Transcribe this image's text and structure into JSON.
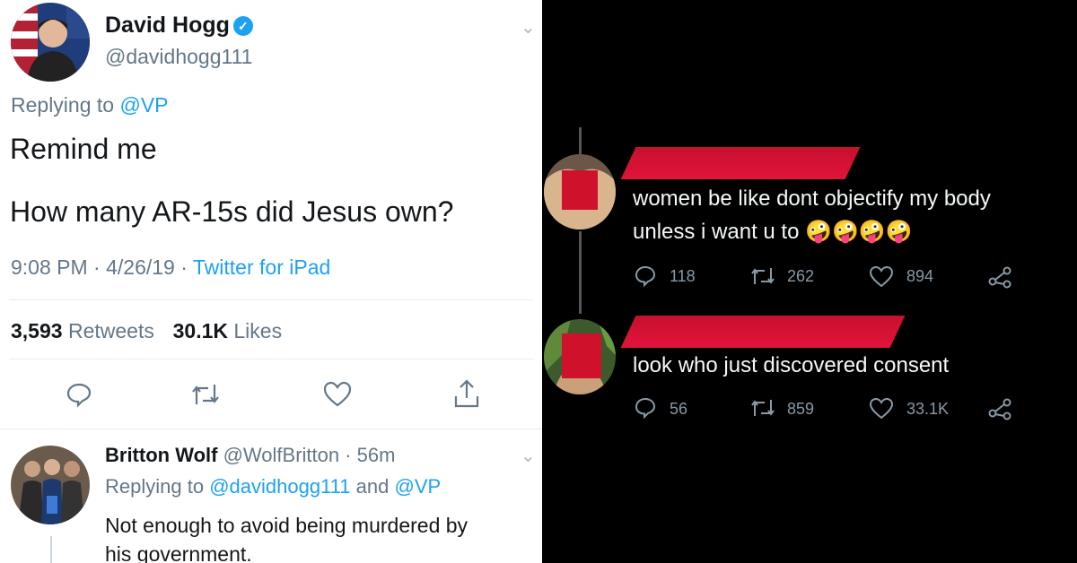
{
  "tweet": {
    "name": "David Hogg",
    "handle": "@davidhogg111",
    "replying_prefix": "Replying to",
    "replying_to": "@VP",
    "line1": "Remind me",
    "line2": "How many AR-15s did Jesus own?",
    "time": "9:08 PM",
    "date": "4/26/19",
    "source": "Twitter for iPad",
    "retweets_count": "3,593",
    "retweets_label": "Retweets",
    "likes_count": "30.1K",
    "likes_label": "Likes"
  },
  "reply": {
    "name": "Britton Wolf",
    "handle": "@WolfBritton",
    "age": "56m",
    "replying_prefix": "Replying to",
    "replying_to_1": "@davidhogg111",
    "and": "and",
    "replying_to_2": "@VP",
    "text_line1": "Not enough to avoid being murdered by",
    "text_line2": "his government."
  },
  "dark_tweet_1": {
    "line1": "women be like dont objectify my body",
    "line2": "unless i want u to",
    "emojis": "🤪🤪🤪🤪",
    "replies": "118",
    "retweets": "262",
    "likes": "894"
  },
  "dark_tweet_2": {
    "text": "look who just discovered consent",
    "replies": "56",
    "retweets": "859",
    "likes": "33.1K"
  },
  "icons": [
    "reply-icon",
    "retweet-icon",
    "like-icon",
    "share-icon",
    "chevron-down-icon",
    "verified-icon"
  ],
  "colors": {
    "link": "#1da1f2",
    "muted": "#657786",
    "redaction": "#d0112c"
  }
}
